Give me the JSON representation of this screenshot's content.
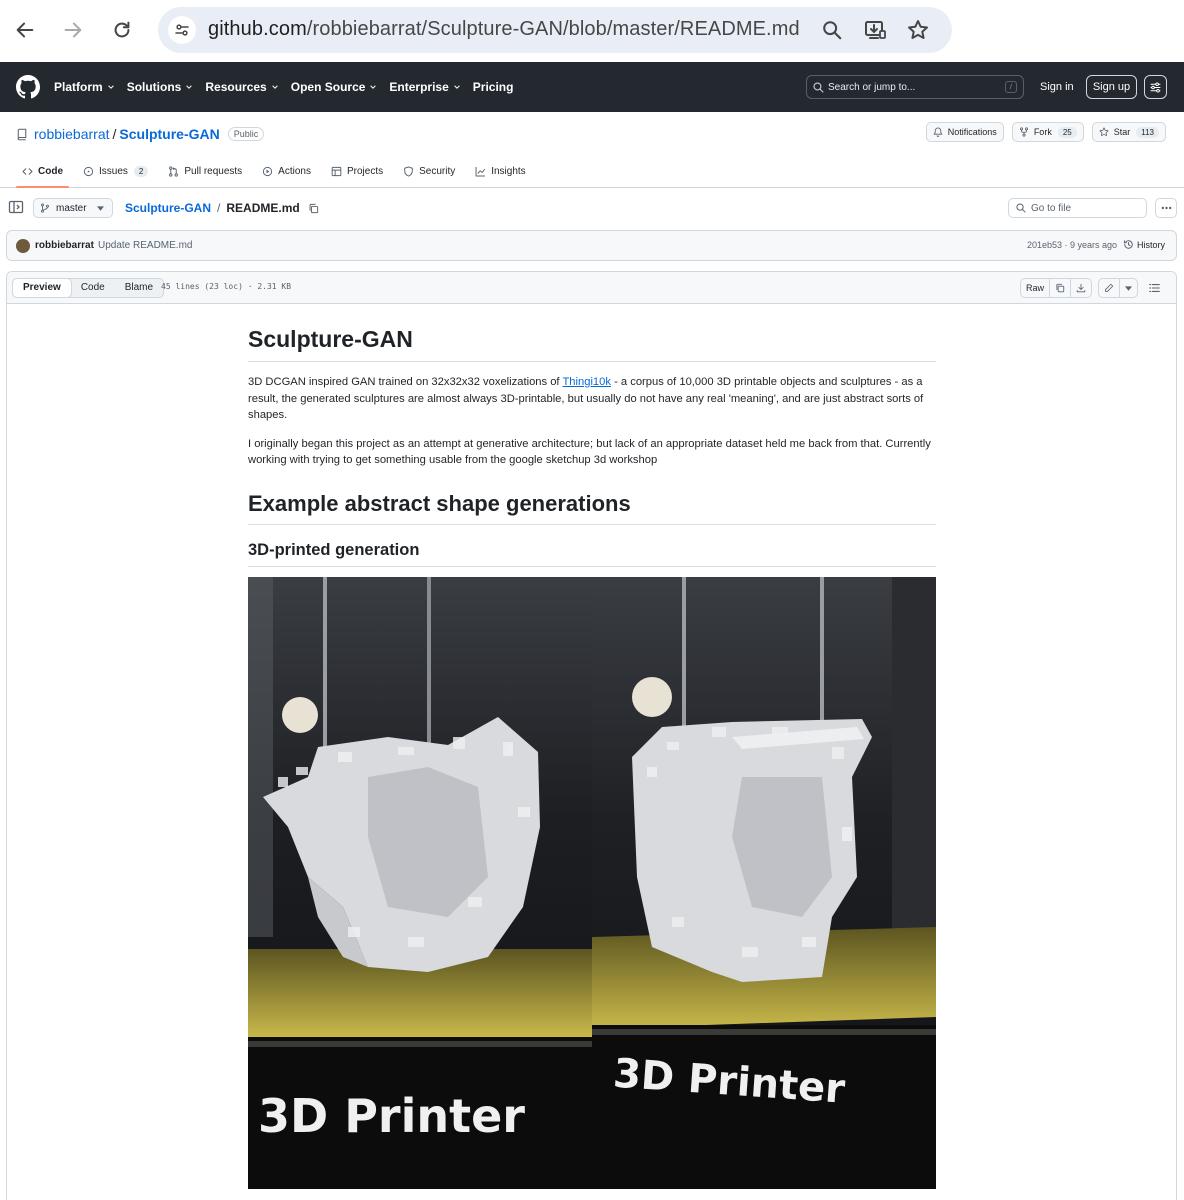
{
  "browser": {
    "url_host": "github.com",
    "url_path": "/robbiebarrat/Sculpture-GAN/blob/master/README.md"
  },
  "header": {
    "nav": [
      "Platform",
      "Solutions",
      "Resources",
      "Open Source",
      "Enterprise"
    ],
    "pricing": "Pricing",
    "search_placeholder": "Search or jump to...",
    "search_kbd": "/",
    "sign_in": "Sign in",
    "sign_up": "Sign up"
  },
  "repo": {
    "owner": "robbiebarrat",
    "sep": "/",
    "name": "Sculpture-GAN",
    "visibility": "Public",
    "notifications": "Notifications",
    "fork_label": "Fork",
    "fork_count": "25",
    "star_label": "Star",
    "star_count": "113"
  },
  "tabs": [
    {
      "label": "Code"
    },
    {
      "label": "Issues",
      "count": "2"
    },
    {
      "label": "Pull requests"
    },
    {
      "label": "Actions"
    },
    {
      "label": "Projects"
    },
    {
      "label": "Security"
    },
    {
      "label": "Insights"
    }
  ],
  "path": {
    "branch": "master",
    "repo": "Sculpture-GAN",
    "sep": "/",
    "file": "README.md",
    "goto_placeholder": "Go to file"
  },
  "commit": {
    "author": "robbiebarrat",
    "message": "Update README.md",
    "meta": "201eb53 · 9 years ago",
    "history": "History"
  },
  "fileview": {
    "tabs": [
      "Preview",
      "Code",
      "Blame"
    ],
    "info": "45 lines (23 loc) · 2.31 KB",
    "raw": "Raw"
  },
  "readme": {
    "title": "Sculpture-GAN",
    "p1_before": "3D DCGAN inspired GAN trained on 32x32x32 voxelizations of ",
    "p1_link": "Thingi10k",
    "p1_after": " - a corpus of 10,000 3D printable objects and sculptures - as a result, the generated sculptures are almost always 3D-printable, but usually do not have any real 'meaning', and are just abstract sorts of shapes.",
    "p2": "I originally began this project as an attempt at generative architecture; but lack of an appropriate dataset held me back from that. Currently working with trying to get something usable from the google sketchup 3d workshop",
    "h2": "Example abstract shape generations",
    "h3": "3D-printed generation",
    "printer_text": "3D Printer"
  },
  "colors": {
    "header_bg": "#24292f",
    "link": "#0969da",
    "active_tab": "#fd8c73"
  }
}
